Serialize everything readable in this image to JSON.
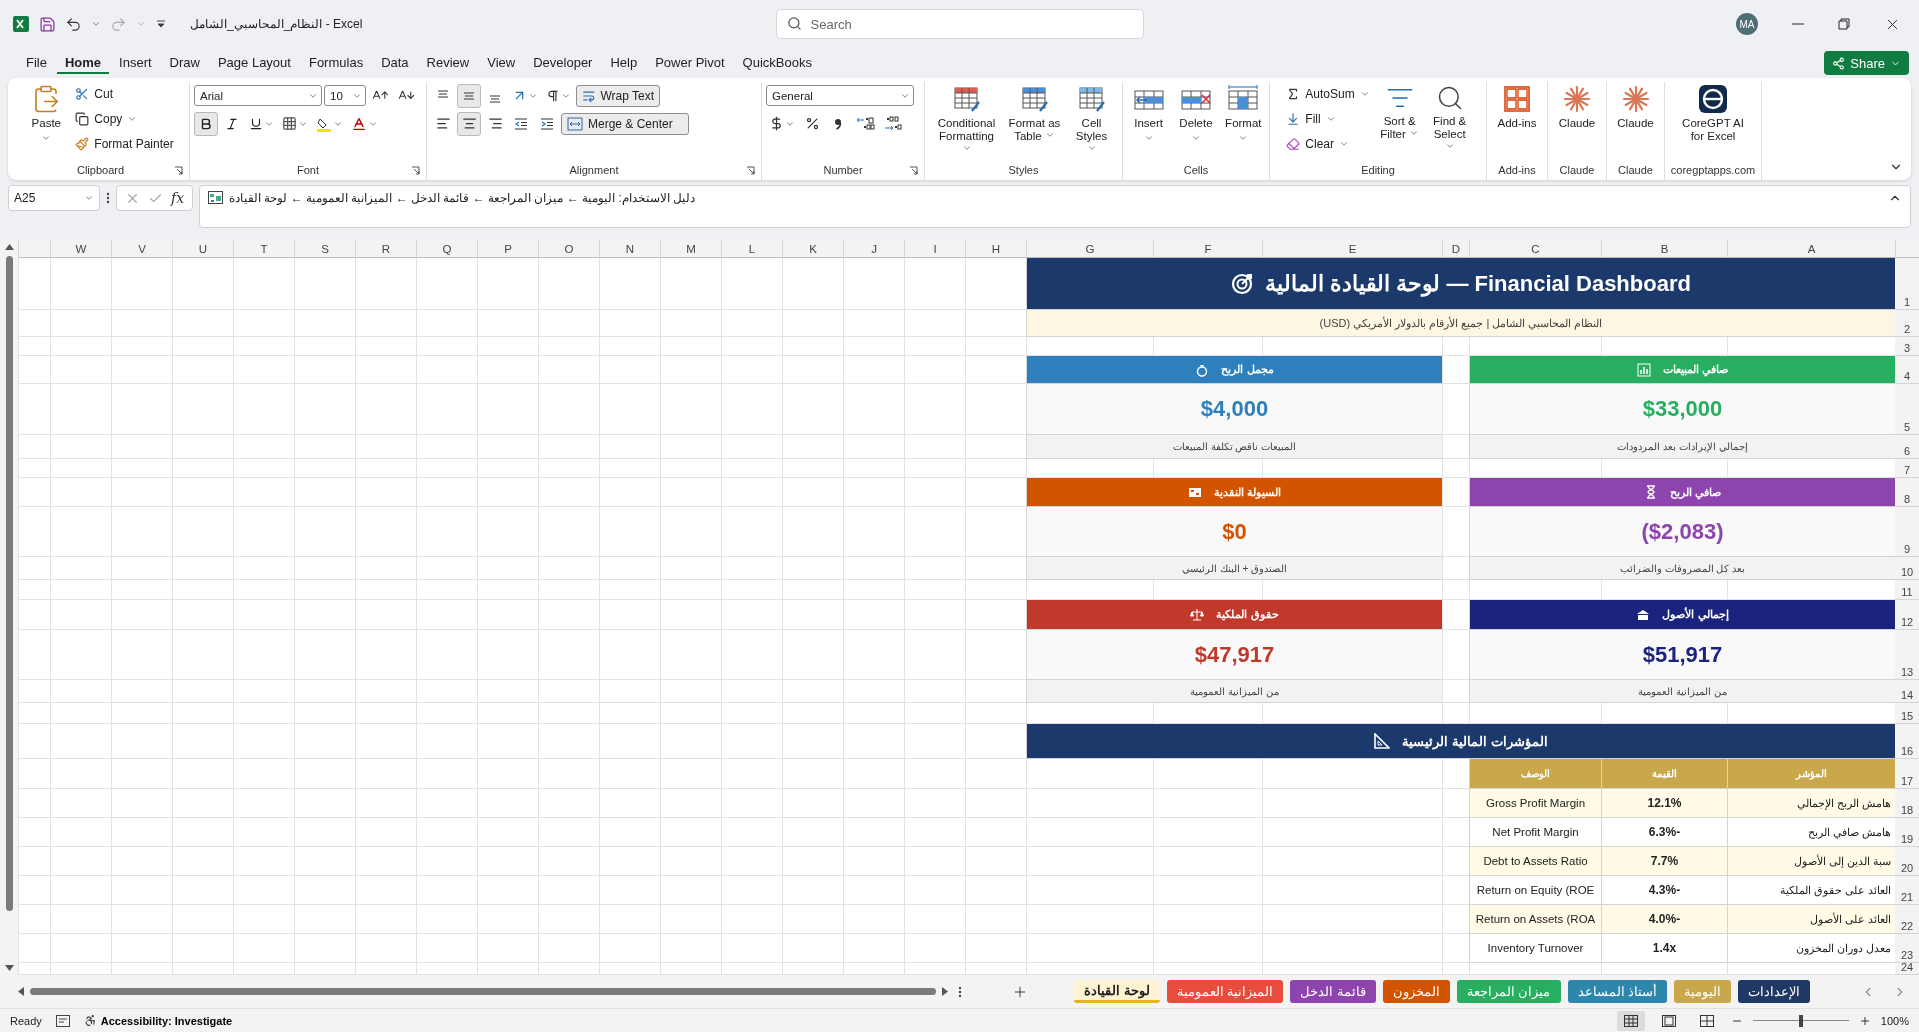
{
  "title_bar": {
    "title": "النظام_المحاسبي_الشامل - Excel",
    "search_placeholder": "Search",
    "avatar": "MA"
  },
  "menu": [
    {
      "label": "QuickBooks",
      "selected": false
    },
    {
      "label": "Power Pivot",
      "selected": false
    },
    {
      "label": "Help",
      "selected": false
    },
    {
      "label": "Developer",
      "selected": false
    },
    {
      "label": "View",
      "selected": false
    },
    {
      "label": "Review",
      "selected": false
    },
    {
      "label": "Data",
      "selected": false
    },
    {
      "label": "Formulas",
      "selected": false
    },
    {
      "label": "Page Layout",
      "selected": false
    },
    {
      "label": "Draw",
      "selected": false
    },
    {
      "label": "Insert",
      "selected": false
    },
    {
      "label": "Home",
      "selected": true
    },
    {
      "label": "File",
      "selected": false
    }
  ],
  "share": "Share",
  "ribbon": {
    "clipboard": {
      "label": "Clipboard",
      "paste": "Paste",
      "cut": "Cut",
      "copy": "Copy",
      "format_painter": "Format Painter"
    },
    "font": {
      "label": "Font",
      "name": "Arial",
      "size": "10",
      "bold": true,
      "italic": false,
      "underline": false
    },
    "alignment": {
      "label": "Alignment",
      "vertical": [
        {
          "selected": false
        },
        {
          "selected": true
        },
        {
          "selected": false
        }
      ],
      "horizontal": [
        {
          "selected": false
        },
        {
          "selected": true
        },
        {
          "selected": false
        }
      ],
      "wrap_text": "Wrap Text",
      "wrap_on": true,
      "merge": "Merge & Center",
      "merge_on": true
    },
    "number": {
      "label": "Number",
      "format": "General"
    },
    "styles": {
      "label": "Styles",
      "items": [
        "Cell Styles",
        "Format as Table",
        "Conditional Formatting"
      ]
    },
    "cells": {
      "label": "Cells",
      "items": [
        "Format",
        "Delete",
        "Insert"
      ]
    },
    "editing": {
      "label": "Editing",
      "autosum": "AutoSum",
      "fill": "Fill",
      "clear": "Clear",
      "sort": "Sort & Filter",
      "find": "Find & Select"
    },
    "addins": [
      {
        "kind": "coregpt",
        "button": "CoreGPT AI for Excel",
        "label": "coregptapps.com"
      },
      {
        "kind": "claude",
        "button": "Claude",
        "label": "Claude"
      },
      {
        "kind": "claude",
        "button": "Claude",
        "label": "Claude"
      },
      {
        "kind": "addins",
        "button": "Add-ins",
        "label": "Add-ins"
      }
    ]
  },
  "formula_bar": {
    "name_box": "A25",
    "function_label": "fx",
    "content": "دليل الاستخدام: اليومية ← ميزان المراجعة ← قائمة الدخل ← الميزانية العمومية ← لوحة القيادة"
  },
  "columns": [
    "A",
    "B",
    "C",
    "D",
    "E",
    "F",
    "G",
    "H",
    "I",
    "J",
    "K",
    "L",
    "M",
    "N",
    "O",
    "P",
    "Q",
    "R",
    "S",
    "T",
    "U",
    "V",
    "W"
  ],
  "rows": [
    "1",
    "2",
    "3",
    "4",
    "5",
    "6",
    "7",
    "8",
    "9",
    "10",
    "11",
    "12",
    "13",
    "14",
    "15",
    "16",
    "17",
    "18",
    "19",
    "20",
    "21",
    "22",
    "23",
    "24"
  ],
  "dashboard": {
    "title": "لوحة القيادة المالية — Financial Dashboard",
    "subtitle": "النظام المحاسبي الشامل | جميع الأرقام بالدولار الأمريكي (USD)",
    "cards": [
      {
        "title": "صافي المبيعات",
        "value": "$33,000",
        "note": "إجمالي الإيرادات بعد المردودات",
        "color": "#27ae60"
      },
      {
        "title": "مجمل الربح",
        "value": "$4,000",
        "note": "المبيعات ناقص تكلفة المبيعات",
        "color": "#2e80bd"
      },
      {
        "title": "صافي الربح",
        "value": "($2,083)",
        "note": "بعد كل المصروفات والضرائب",
        "color": "#8e44ad"
      },
      {
        "title": "السيولة النقدية",
        "value": "$0",
        "note": "الصندوق + البنك الرئيسي",
        "color": "#d35400"
      },
      {
        "title": "إجمالي الأصول",
        "value": "$51,917",
        "note": "من الميزانية العمومية",
        "color": "#1a237e"
      },
      {
        "title": "حقوق الملكية",
        "value": "$47,917",
        "note": "من الميزانية العمومية",
        "color": "#c0392b"
      }
    ],
    "section_title": "المؤشرات المالية الرئيسية",
    "table": {
      "columns": [
        "المؤشر",
        "القيمة",
        "الوصف"
      ],
      "rows": [
        {
          "indicator": "هامش الربح الإجمالي",
          "value": "12.1%",
          "description": "Gross Profit Margin",
          "shaded": true
        },
        {
          "indicator": "هامش صافي الربح",
          "value": "-6.3%",
          "description": "Net Profit Margin",
          "shaded": false
        },
        {
          "indicator": "سبة الدين إلى الأصول",
          "value": "7.7%",
          "description": "Debt to Assets Ratio",
          "shaded": true
        },
        {
          "indicator": "العائد على حقوق الملكية",
          "value": "-4.3%",
          "description": "Return on Equity (ROE",
          "shaded": false
        },
        {
          "indicator": "العائد على الأصول",
          "value": "-4.0%",
          "description": "Return on Assets (ROA",
          "shaded": true
        },
        {
          "indicator": "معدل دوران المخزون",
          "value": "1.4x",
          "description": "Inventory Turnover",
          "shaded": false
        }
      ]
    }
  },
  "sheet_tabs": [
    {
      "label": "الإعدادات",
      "color": "#1f3864",
      "selected": false
    },
    {
      "label": "اليومية",
      "color": "#c9a84c",
      "selected": false
    },
    {
      "label": "أستاذ المساعد",
      "color": "#2e86ab",
      "selected": false
    },
    {
      "label": "ميزان المراجعة",
      "color": "#27ae60",
      "selected": false
    },
    {
      "label": "المخزون",
      "color": "#d35400",
      "selected": false
    },
    {
      "label": "قائمة الدخل",
      "color": "#8e44ad",
      "selected": false
    },
    {
      "label": "الميزانية العمومية",
      "color": "#e74c3c",
      "selected": false
    },
    {
      "label": "لوحة القيادة",
      "color": "#e6b422",
      "selected": true
    }
  ],
  "status_bar": {
    "ready": "Ready",
    "accessibility": "Accessibility: Investigate",
    "views": [
      {
        "selected": true
      },
      {
        "selected": false
      },
      {
        "selected": false
      }
    ],
    "zoom": {
      "level": 0.5,
      "reading": "100%"
    }
  }
}
